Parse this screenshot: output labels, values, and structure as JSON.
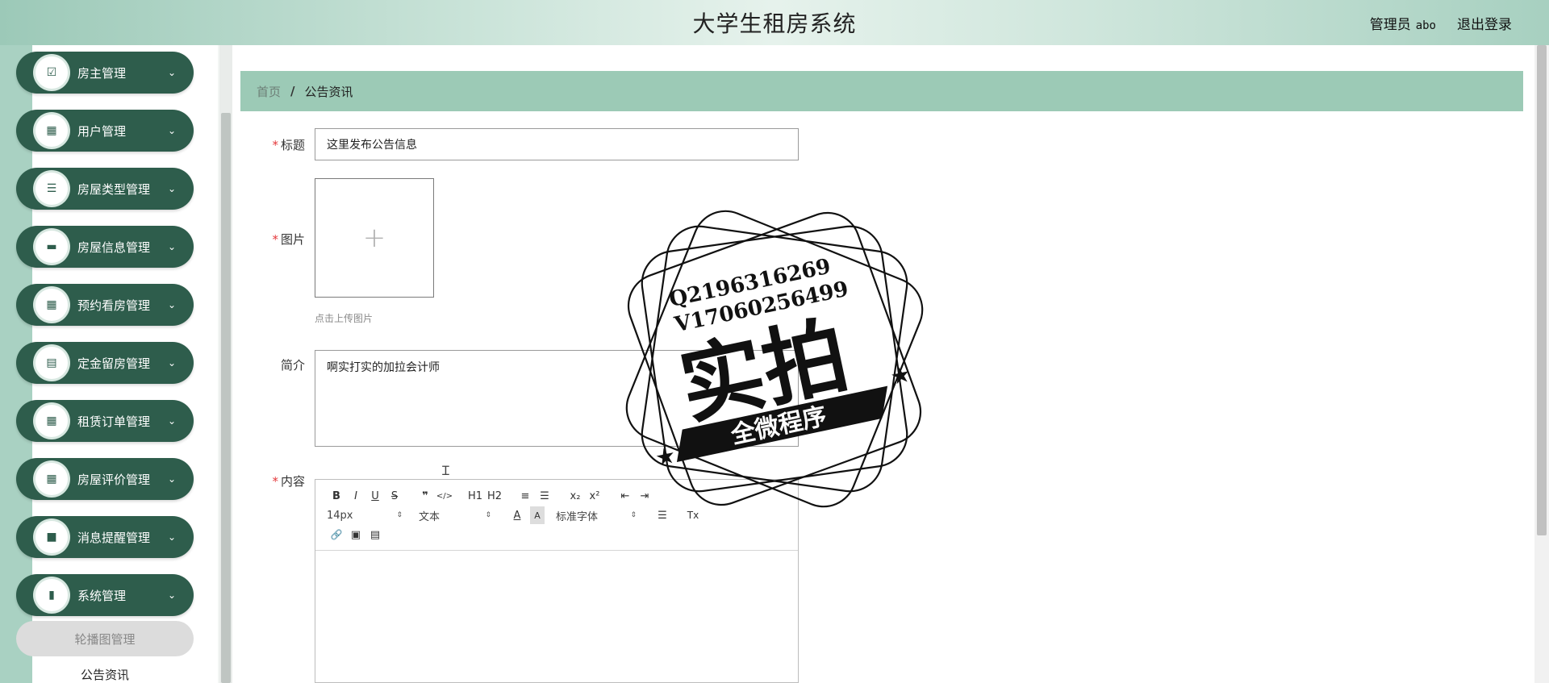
{
  "header": {
    "title": "大学生租房系统",
    "user_role": "管理员",
    "user_name": "abo",
    "logout": "退出登录"
  },
  "sidebar": {
    "items": [
      {
        "label": "房主管理",
        "icon": "check-clipboard-icon",
        "glyph": "☑"
      },
      {
        "label": "用户管理",
        "icon": "grid-icon",
        "glyph": "▦"
      },
      {
        "label": "房屋类型管理",
        "icon": "list-icon",
        "glyph": "☰"
      },
      {
        "label": "房屋信息管理",
        "icon": "briefcase-icon",
        "glyph": "▬"
      },
      {
        "label": "预约看房管理",
        "icon": "grid-icon",
        "glyph": "▦"
      },
      {
        "label": "定金留房管理",
        "icon": "clipboard-icon",
        "glyph": "▤"
      },
      {
        "label": "租赁订单管理",
        "icon": "grid-icon",
        "glyph": "▦"
      },
      {
        "label": "房屋评价管理",
        "icon": "grid-icon",
        "glyph": "▦"
      },
      {
        "label": "消息提醒管理",
        "icon": "message-icon",
        "glyph": "■"
      },
      {
        "label": "系统管理",
        "icon": "book-icon",
        "glyph": "▮"
      }
    ],
    "submenu": {
      "active": "轮播图管理",
      "next": "公告资讯"
    },
    "chevron": "⌄"
  },
  "breadcrumb": {
    "home": "首页",
    "separator": "/",
    "current": "公告资讯"
  },
  "form": {
    "title": {
      "label": "标题",
      "value": "这里发布公告信息"
    },
    "image": {
      "label": "图片",
      "hint": "点击上传图片",
      "plus": "+"
    },
    "summary": {
      "label": "简介",
      "value": "啊实打实的加拉会计师"
    },
    "content": {
      "label": "内容"
    }
  },
  "editor": {
    "row1": [
      "B",
      "I",
      "U",
      "S",
      "❞",
      "</>",
      "H1",
      "H2",
      "≡",
      "☰",
      "x₂",
      "x²",
      "⇤",
      "⇥"
    ],
    "row2": {
      "size": "14px",
      "format": "文本",
      "font": "标准字体",
      "color_glyph": "A",
      "bg_glyph": "A",
      "align_glyph": "☰",
      "clear_glyph": "Tx"
    },
    "row3": [
      "🔗",
      "▣",
      "▤"
    ]
  },
  "watermark": {
    "qq": "Q2196316269",
    "wechat": "V17060256499",
    "big": "实拍",
    "ribbon": "全微程序"
  },
  "colors": {
    "accent": "#2e5d4c",
    "breadcrumb_bg": "#9ccab6",
    "required": "#e4393c"
  }
}
